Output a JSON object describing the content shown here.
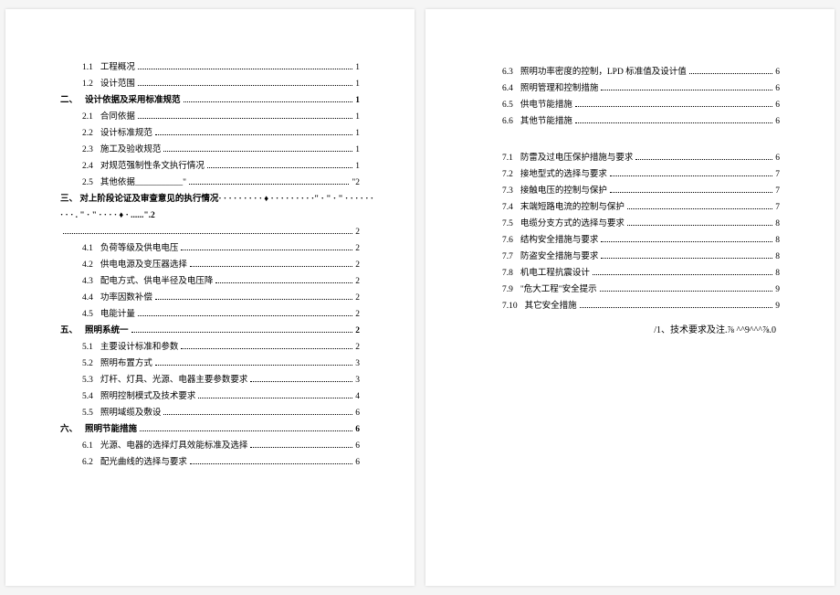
{
  "left_page": {
    "entries": [
      {
        "type": "sub",
        "num": "1.1",
        "label": "工程概况",
        "page": "1"
      },
      {
        "type": "sub",
        "num": "1.2",
        "label": "设计范围",
        "page": "1"
      },
      {
        "type": "heading",
        "num": "二、",
        "label": "设计依据及采用标准规范",
        "page": "1"
      },
      {
        "type": "sub",
        "num": "2.1",
        "label": "合同依据",
        "page": "1"
      },
      {
        "type": "sub",
        "num": "2.2",
        "label": "设计标准规范",
        "page": "1"
      },
      {
        "type": "sub",
        "num": "2.3",
        "label": "施工及验收规范",
        "page": "1"
      },
      {
        "type": "sub",
        "num": "2.4",
        "label": "对规范强制性条文执行情况",
        "page": "1"
      },
      {
        "type": "sub",
        "num": "2.5",
        "label": "其他依据___________\"",
        "page_prefix": "\"",
        "page": "2"
      },
      {
        "type": "sec3",
        "num": "三、",
        "label_line1": "对上阶段论证及审查意见的执行情况·   ·  ·  ·  ·  · · · · ♦ · · · · · · · · ·\"  ·  \" · \" · · · · · ·",
        "label_line2": "·  ·  · . \" · \" · · · · ♦ · ......\".2"
      },
      {
        "type": "continuation",
        "page": "2"
      },
      {
        "type": "sub",
        "num": "4.1",
        "label": "负荷等级及供电电压",
        "page": "2"
      },
      {
        "type": "sub",
        "num": "4.2",
        "label": "供电电源及变压器选择",
        "page": "2"
      },
      {
        "type": "sub",
        "num": "4.3",
        "label": "配电方式、供电半径及电压降",
        "page": "2"
      },
      {
        "type": "sub",
        "num": "4.4",
        "label": "功率因数补偿",
        "page": "2"
      },
      {
        "type": "sub",
        "num": "4.5",
        "label": "电能计量",
        "page": "2"
      },
      {
        "type": "heading",
        "num": "五、",
        "label": "照明系统一",
        "page": "2"
      },
      {
        "type": "sub",
        "num": "5.1",
        "label": "主要设计标准和参数",
        "page": "2"
      },
      {
        "type": "sub",
        "num": "5.2",
        "label": "照明布置方式",
        "page": "3"
      },
      {
        "type": "sub",
        "num": "5.3",
        "label": "灯杆、灯具、光源、电器主要参数要求",
        "page": "3"
      },
      {
        "type": "sub",
        "num": "5.4",
        "label": "照明控制模式及技术要求",
        "page": "4"
      },
      {
        "type": "sub",
        "num": "5.5",
        "label": "照明域缆及敷设",
        "page": "6"
      },
      {
        "type": "heading",
        "num": "六、",
        "label": "照明节能措施",
        "page": "6"
      },
      {
        "type": "sub",
        "num": "6.1",
        "label": "光源、电器的选择灯具效能标准及选择",
        "page": "6"
      },
      {
        "type": "sub",
        "num": "6.2",
        "label": "配光曲线的选择与要求",
        "page": "6"
      }
    ]
  },
  "right_page": {
    "entries": [
      {
        "type": "sub",
        "num": "6.3",
        "label": "照明功率密度的控制，LPD 标准值及设计值",
        "page": "6"
      },
      {
        "type": "sub",
        "num": "6.4",
        "label": "照明管理和控制措施",
        "page": "6"
      },
      {
        "type": "sub",
        "num": "6.5",
        "label": "供电节能措施",
        "page": "6"
      },
      {
        "type": "sub",
        "num": "6.6",
        "label": "其他节能措施",
        "page": "6"
      },
      {
        "type": "spacer"
      },
      {
        "type": "sub",
        "num": "7.1",
        "label": "防雷及过电压保护措施与要求",
        "page": "6"
      },
      {
        "type": "sub",
        "num": "7.2",
        "label": "接地型式的选择与要求",
        "page": "7"
      },
      {
        "type": "sub",
        "num": "7.3",
        "label": "接触电压的控制与保护",
        "page": "7"
      },
      {
        "type": "sub",
        "num": "7.4",
        "label": "末端短路电流的控制与保护",
        "page": "7"
      },
      {
        "type": "sub",
        "num": "7.5",
        "label": "电缆分支方式的选择与要求",
        "page": "8"
      },
      {
        "type": "sub",
        "num": "7.6",
        "label": "结构安全措施与要求",
        "page": "8"
      },
      {
        "type": "sub",
        "num": "7.7",
        "label": "防盗安全措施与要求",
        "page": "8"
      },
      {
        "type": "sub",
        "num": "7.8",
        "label": "机电工程抗震设计",
        "page": "8"
      },
      {
        "type": "sub",
        "num": "7.9",
        "label": "\"危大工程\"安全提示",
        "page": "9"
      },
      {
        "type": "sub",
        "num": "7.10",
        "label": "其它安全措施",
        "page": "9"
      }
    ],
    "footnote": "/1、技术要求及注.⅞ ^^9^^^⅞.0"
  }
}
